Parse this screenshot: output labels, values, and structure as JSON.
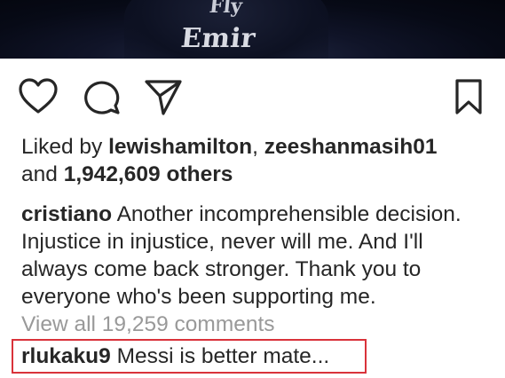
{
  "photo": {
    "sponsor_top": "Fly",
    "sponsor_main": "Emir"
  },
  "icons": {
    "like": "heart-icon",
    "comment": "comment-bubble-icon",
    "share": "paper-plane-icon",
    "save": "bookmark-icon"
  },
  "likes": {
    "prefix": "Liked by ",
    "user1": "lewishamilton",
    "separator": ", ",
    "user2": "zeeshanmasih01",
    "and": "and ",
    "others": "1,942,609 others"
  },
  "caption": {
    "username": "cristiano",
    "text": " Another incomprehensible decision. Injustice in injustice, never will me. And I'll always come back stronger. Thank you to everyone who's been supporting me."
  },
  "view_all_comments": "View all 19,259 comments",
  "comment": {
    "username": "rlukaku9",
    "text": " Messi is better mate..."
  },
  "colors": {
    "text": "#262626",
    "muted": "#999999",
    "highlight_border": "#d9323a"
  }
}
